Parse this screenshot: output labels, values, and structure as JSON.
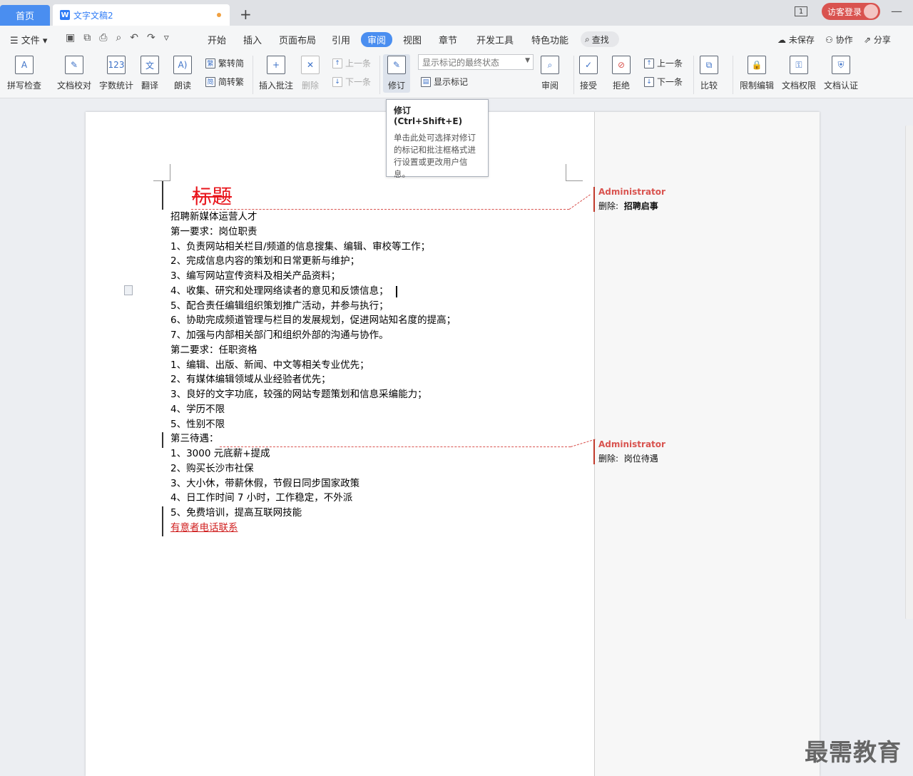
{
  "titlebar": {
    "home_tab": "首页",
    "doc_tab": "文字文稿2",
    "add_tab": "+",
    "window_num": "1",
    "login": "访客登录"
  },
  "menu": {
    "file": "☰ 文件 ▾",
    "tabs": [
      "开始",
      "插入",
      "页面布局",
      "引用",
      "审阅",
      "视图",
      "章节",
      "开发工具",
      "特色功能"
    ],
    "active_tab": "审阅",
    "search": "查找",
    "unsaved": "未保存",
    "collab": "协作",
    "share": "分享"
  },
  "ribbon": {
    "spell_check": "拼写检查",
    "doc_proof": "文档校对",
    "word_count": "字数统计",
    "translate": "翻译",
    "read_aloud": "朗读",
    "trad_to_simp": "繁转简",
    "simp_to_trad": "简转繁",
    "insert_comment": "插入批注",
    "delete": "删除",
    "prev_comment": "上一条",
    "next_comment": "下一条",
    "track_changes": "修订",
    "markup_select": "显示标记的最终状态",
    "show_markup": "显示标记",
    "review": "审阅",
    "accept": "接受",
    "reject": "拒绝",
    "prev_change": "上一条",
    "next_change": "下一条",
    "compare": "比较",
    "restrict_edit": "限制编辑",
    "doc_rights": "文档权限",
    "doc_cert": "文档认证"
  },
  "tooltip": {
    "title": "修订 (Ctrl+Shift+E)",
    "body": "单击此处可选择对修订的标记和批注框格式进行设置或更改用户信息。"
  },
  "document": {
    "title": "标题",
    "lines": [
      "招聘新媒体运营人才",
      "第一要求：岗位职责",
      "1、负责网站相关栏目/频道的信息搜集、编辑、审校等工作；",
      "2、完成信息内容的策划和日常更新与维护；",
      "3、编写网站宣传资料及相关产品资料；",
      "4、收集、研究和处理网络读者的意见和反馈信息；",
      "5、配合责任编辑组织策划推广活动，并参与执行；",
      "6、协助完成频道管理与栏目的发展规划，促进网站知名度的提高；",
      "7、加强与内部相关部门和组织外部的沟通与协作。",
      "第二要求：任职资格",
      "1、编辑、出版、新闻、中文等相关专业优先；",
      "2、有媒体编辑领域从业经验者优先；",
      "3、良好的文字功底，较强的网站专题策划和信息采编能力；",
      "4、学历不限",
      "5、性别不限",
      "第三待遇：",
      "1、3000 元底薪+提成",
      "2、购买长沙市社保",
      "3、大小休，带薪休假，节假日同步国家政策",
      "4、日工作时间 7 小时，工作稳定，不外派",
      "5、免费培训，提高互联网技能"
    ],
    "last_line": "有意者电话联系"
  },
  "comments": [
    {
      "author": "Administrator",
      "label": "删除:",
      "text": "招聘启事"
    },
    {
      "author": "Administrator",
      "label": "删除:",
      "text": "岗位待遇"
    }
  ],
  "watermark": "最需教育"
}
